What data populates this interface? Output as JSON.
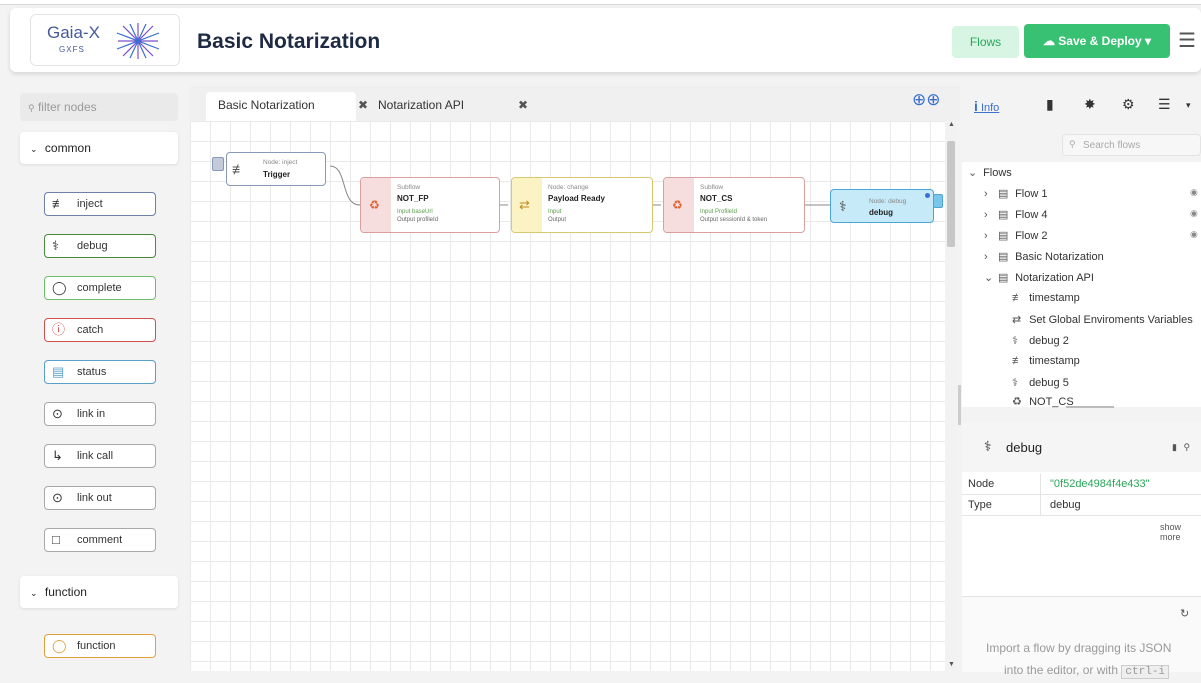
{
  "header": {
    "logo_text": "Gaia-X",
    "logo_sub": "GXFS",
    "title": "Basic Notarization",
    "flows_button": "Flows",
    "deploy_button": "Save & Deploy",
    "deploy_icon": "cloud-upload-icon",
    "menu_icon": "hamburger-icon"
  },
  "palette": {
    "filter_placeholder": "filter nodes",
    "categories": [
      {
        "label": "common",
        "nodes": [
          {
            "label": "inject",
            "icon": "inject-icon",
            "color": "#6f7fa8"
          },
          {
            "label": "debug",
            "icon": "debug-icon",
            "color": "#4a8a3c"
          },
          {
            "label": "complete",
            "icon": "complete-icon",
            "color": "#6cbf6c"
          },
          {
            "label": "catch",
            "icon": "catch-icon",
            "color": "#d05050"
          },
          {
            "label": "status",
            "icon": "status-icon",
            "color": "#5a9fc9"
          },
          {
            "label": "link in",
            "icon": "link-in-icon",
            "color": "#a8a8a8"
          },
          {
            "label": "link call",
            "icon": "link-call-icon",
            "color": "#a8a8a8"
          },
          {
            "label": "link out",
            "icon": "link-out-icon",
            "color": "#a8a8a8"
          },
          {
            "label": "comment",
            "icon": "comment-icon",
            "color": "#a8a8a8"
          }
        ]
      },
      {
        "label": "function",
        "nodes": [
          {
            "label": "function",
            "icon": "function-icon",
            "color": "#e0a040"
          }
        ]
      }
    ]
  },
  "workspace": {
    "tabs": [
      {
        "label": "Basic Notarization",
        "active": true
      },
      {
        "label": "Notarization API",
        "active": false
      }
    ],
    "nodes": [
      {
        "kind": "Node: inject",
        "name": "Trigger"
      },
      {
        "kind": "Subflow",
        "name": "NOT_FP",
        "in": "Input baseUrl",
        "out": "Output profileId"
      },
      {
        "kind": "Node: change",
        "name": "Payload Ready",
        "in": "Input",
        "out": "Output"
      },
      {
        "kind": "Subflow",
        "name": "NOT_CS",
        "in": "Input ProfileId",
        "out": "Output sessionId & token"
      },
      {
        "kind": "Node: debug",
        "name": "debug"
      }
    ]
  },
  "sidebar": {
    "tabs": [
      {
        "label": "Info",
        "icon": "info-icon"
      },
      {
        "label": "",
        "icon": "book-icon"
      },
      {
        "label": "",
        "icon": "bug-icon"
      },
      {
        "label": "",
        "icon": "gear-icon"
      },
      {
        "label": "",
        "icon": "database-icon"
      }
    ],
    "search_placeholder": "Search flows",
    "tree_root": "Flows",
    "flows": [
      {
        "label": "Flow 1"
      },
      {
        "label": "Flow 4"
      },
      {
        "label": "Flow 2"
      },
      {
        "label": "Basic Notarization"
      },
      {
        "label": "Notarization API"
      }
    ],
    "children": [
      {
        "label": "timestamp",
        "icon": "inject-icon"
      },
      {
        "label": "Set Global Enviroments Variables",
        "icon": "change-icon"
      },
      {
        "label": "debug 2",
        "icon": "debug-icon"
      },
      {
        "label": "timestamp",
        "icon": "inject-icon"
      },
      {
        "label": "debug 5",
        "icon": "debug-icon"
      },
      {
        "label": "NOT_CS",
        "icon": "subflow-icon"
      }
    ],
    "info": {
      "title": "debug",
      "rows": [
        {
          "key": "Node",
          "value": "\"0f52de4984f4e433\""
        },
        {
          "key": "Type",
          "value": "debug"
        }
      ],
      "show_more": "show more",
      "help_text_1": "Import a flow by dragging its JSON",
      "help_text_2": "into the editor, or with",
      "help_shortcut": "ctrl-i"
    }
  }
}
